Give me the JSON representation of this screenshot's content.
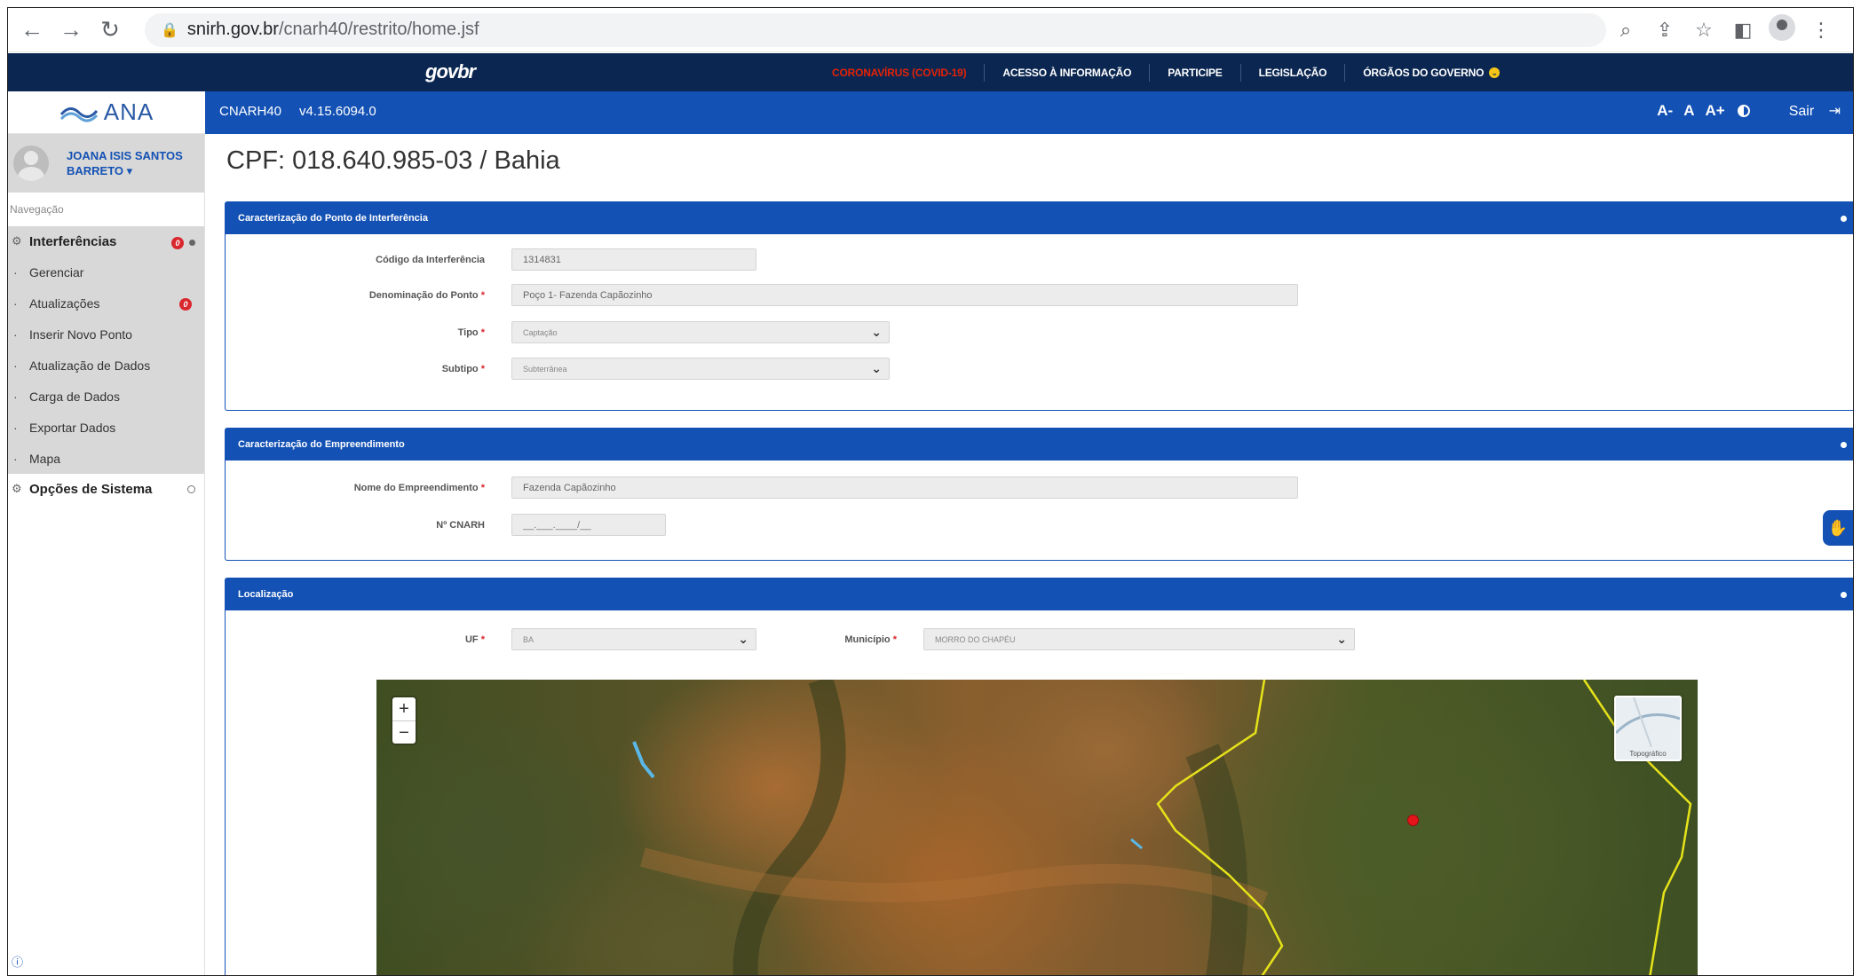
{
  "browser": {
    "url_host": "snirh.gov.br",
    "url_path": "/cnarh40/restrito/home.jsf"
  },
  "gov": {
    "logo": "govbr",
    "links": [
      "CORONAVÍRUS (COVID-19)",
      "ACESSO À INFORMAÇÃO",
      "PARTICIPE",
      "LEGISLAÇÃO",
      "ÓRGÃOS DO GOVERNO"
    ]
  },
  "header": {
    "brand": "ANA",
    "app_name": "CNARH40",
    "version": "v4.15.6094.0",
    "font_decrease": "A-",
    "font_normal": "A",
    "font_increase": "A+",
    "logout": "Sair"
  },
  "sidebar": {
    "user_name": "JOANA ISIS SANTOS BARRETO ▾",
    "nav_label": "Navegação",
    "group_interferencias": "Interferências",
    "group_badge": "0",
    "items": [
      {
        "label": "Gerenciar",
        "badge": ""
      },
      {
        "label": "Atualizações",
        "badge": "0"
      },
      {
        "label": "Inserir Novo Ponto",
        "badge": ""
      },
      {
        "label": "Atualização de Dados",
        "badge": ""
      },
      {
        "label": "Carga de Dados",
        "badge": ""
      },
      {
        "label": "Exportar Dados",
        "badge": ""
      },
      {
        "label": "Mapa",
        "badge": ""
      }
    ],
    "group_opcoes": "Opções de Sistema"
  },
  "page": {
    "title": "CPF: 018.640.985-03 / Bahia"
  },
  "panel_ponto": {
    "title": "Caracterização do Ponto de Interferência",
    "codigo_label": "Código da Interferência",
    "codigo_value": "1314831",
    "denominacao_label": "Denominação do Ponto",
    "denominacao_value": "Poço 1- Fazenda Capãozinho",
    "tipo_label": "Tipo",
    "tipo_value": "Captação",
    "subtipo_label": "Subtipo",
    "subtipo_value": "Subterrânea"
  },
  "panel_empreendimento": {
    "title": "Caracterização do Empreendimento",
    "nome_label": "Nome do Empreendimento",
    "nome_value": "Fazenda Capãozinho",
    "cnarh_label": "Nº CNARH",
    "cnarh_placeholder": "__.___.____/__"
  },
  "panel_localizacao": {
    "title": "Localização",
    "uf_label": "UF",
    "uf_value": "BA",
    "municipio_label": "Município",
    "municipio_value": "MORRO DO CHAPÉU",
    "map_zoom_in": "+",
    "map_zoom_out": "−",
    "map_layer_label": "Topográfico"
  },
  "colors": {
    "gov_bar": "#0b2751",
    "primary": "#1351b4",
    "marker": "#e3151a",
    "boundary": "#e6e21a"
  }
}
